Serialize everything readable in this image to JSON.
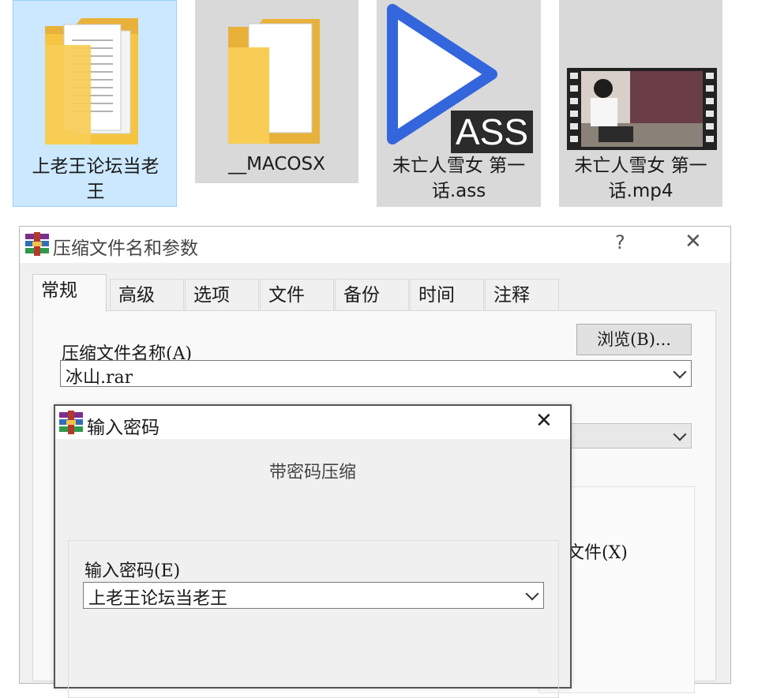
{
  "files": [
    {
      "label": "上老王论坛当老王",
      "icon": "folder-with-documents-icon"
    },
    {
      "label": "__MACOSX",
      "icon": "folder-icon"
    },
    {
      "label": "未亡人雪女 第一话.ass",
      "icon": "play-ass-subtitle-icon",
      "badge": "ASS"
    },
    {
      "label": "未亡人雪女 第一话.mp4",
      "icon": "video-thumbnail-icon"
    }
  ],
  "archive_dialog": {
    "title": "压缩文件名和参数",
    "help_glyph": "?",
    "close_glyph": "✕",
    "tabs": [
      "常规",
      "高级",
      "选项",
      "文件",
      "备份",
      "时间",
      "注释"
    ],
    "archive_name_label": "压缩文件名称(A)",
    "browse_button": "浏览(B)...",
    "archive_name_value": "冰山.rar",
    "partial_option_text": "文件(X)"
  },
  "password_dialog": {
    "title": "输入密码",
    "close_glyph": "✕",
    "heading": "带密码压缩",
    "password_label": "输入密码(E)",
    "password_value": "上老王论坛当老王"
  },
  "colors": {
    "selection_bg": "#cce8ff",
    "tile_bg": "#d9d9d9",
    "play_blue": "#3366dd",
    "folder_yellow": "#f5c542"
  }
}
